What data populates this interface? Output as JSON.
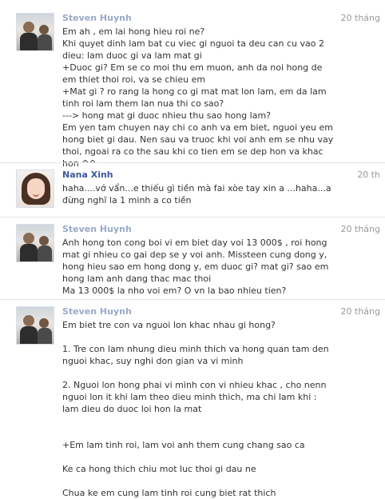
{
  "comments": [
    {
      "author": "Steven Huynh",
      "time": "20 tháng",
      "text": "Em ah , em lai hong hieu roi ne?\nKhi quyet dinh lam bat cu viec gi nguoi ta deu can cu vao 2 dieu: lam duoc gi va lam mat gi\n+Duoc gi? Em se co moi thu em muon, anh da noi hong de em thiet thoi roi, va se chieu em\n+Mat gi ? ro rang la hong co gi mat mat lon lam, em da lam tinh roi lam them lan nua thi co sao?\n---> hong mat gi duoc nhieu thu sao hong lam?\nEm yen tam chuyen nay chi co anh va em biet, nguoi yeu em hong biet gi dau. Nen sau va truoc khi voi anh em se nhu vay thoi, ngoai ra co the sau khi co tien em se dep hon va khac hon ^^"
    },
    {
      "author": "Nana Xinh",
      "time": "20 th",
      "text": "haha....vớ vẩn...e thiếu gì tiền mà fai xòe tay xin a ...haha...a đừng nghĩ la 1 minh a co tiền"
    },
    {
      "author": "Steven Huynh",
      "time": "20 tháng",
      "text": "Anh hong ton cong boi vi em biet day voi 13 000$ , roi hong mat gi nhieu co gai dep se y voi anh. Missteen cung dong y, hong hieu sao em hong dong y, em duoc gi? mat gi? sao em hong lam anh dang thac mac thoi\nMa 13 000$ la nho voi em? O vn la bao nhieu tien?"
    },
    {
      "author": "Steven Huynh",
      "time": "20 tháng",
      "text": "Em biet tre con va nguoi lon khac nhau gi hong?\n\n1. Tre con lam nhung dieu minh thich va hong quan tam den nguoi khac, suy nghi don gian va vi minh\n\n2. Nguoi lon hong phai vi minh con vi nhieu khac , cho nenn nguoi lon it khi lam theo dieu minh thich, ma chi lam khi : lam dieu do duoc loi hon la mat\n\n\n+Em lam tinh roi, lam voi anh them cung chang sao ca\n\nKe ca hong thich chiu mot luc thoi gi dau ne\n\nChua ke em cung lam tinh roi cung biet rat thich"
    }
  ]
}
